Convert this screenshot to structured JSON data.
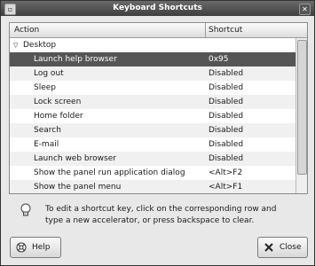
{
  "window": {
    "title": "Keyboard Shortcuts"
  },
  "tree": {
    "columns": {
      "action": "Action",
      "shortcut": "Shortcut"
    },
    "group": {
      "label": "Desktop",
      "expanded": true
    },
    "rows": [
      {
        "action": "Launch help browser",
        "shortcut": "0x95",
        "selected": true
      },
      {
        "action": "Log out",
        "shortcut": "Disabled"
      },
      {
        "action": "Sleep",
        "shortcut": "Disabled"
      },
      {
        "action": "Lock screen",
        "shortcut": "Disabled"
      },
      {
        "action": "Home folder",
        "shortcut": "Disabled"
      },
      {
        "action": "Search",
        "shortcut": "Disabled"
      },
      {
        "action": "E-mail",
        "shortcut": "Disabled"
      },
      {
        "action": "Launch web browser",
        "shortcut": "Disabled"
      },
      {
        "action": "Show the panel run application dialog",
        "shortcut": "<Alt>F2"
      },
      {
        "action": "Show the panel menu",
        "shortcut": "<Alt>F1"
      }
    ]
  },
  "hint": {
    "line1": "To edit a shortcut key, click on the corresponding row and",
    "line2": "type a new accelerator, or press backspace to clear."
  },
  "buttons": {
    "help": "Help",
    "close": "Close"
  },
  "icons": {
    "title": "window-menu-icon",
    "close": "close-icon",
    "bulb": "lightbulb-icon",
    "help": "help-icon",
    "closeButton": "close-x-icon"
  },
  "colors": {
    "selection": "#555555",
    "titlebar": "#4a4a4a"
  }
}
